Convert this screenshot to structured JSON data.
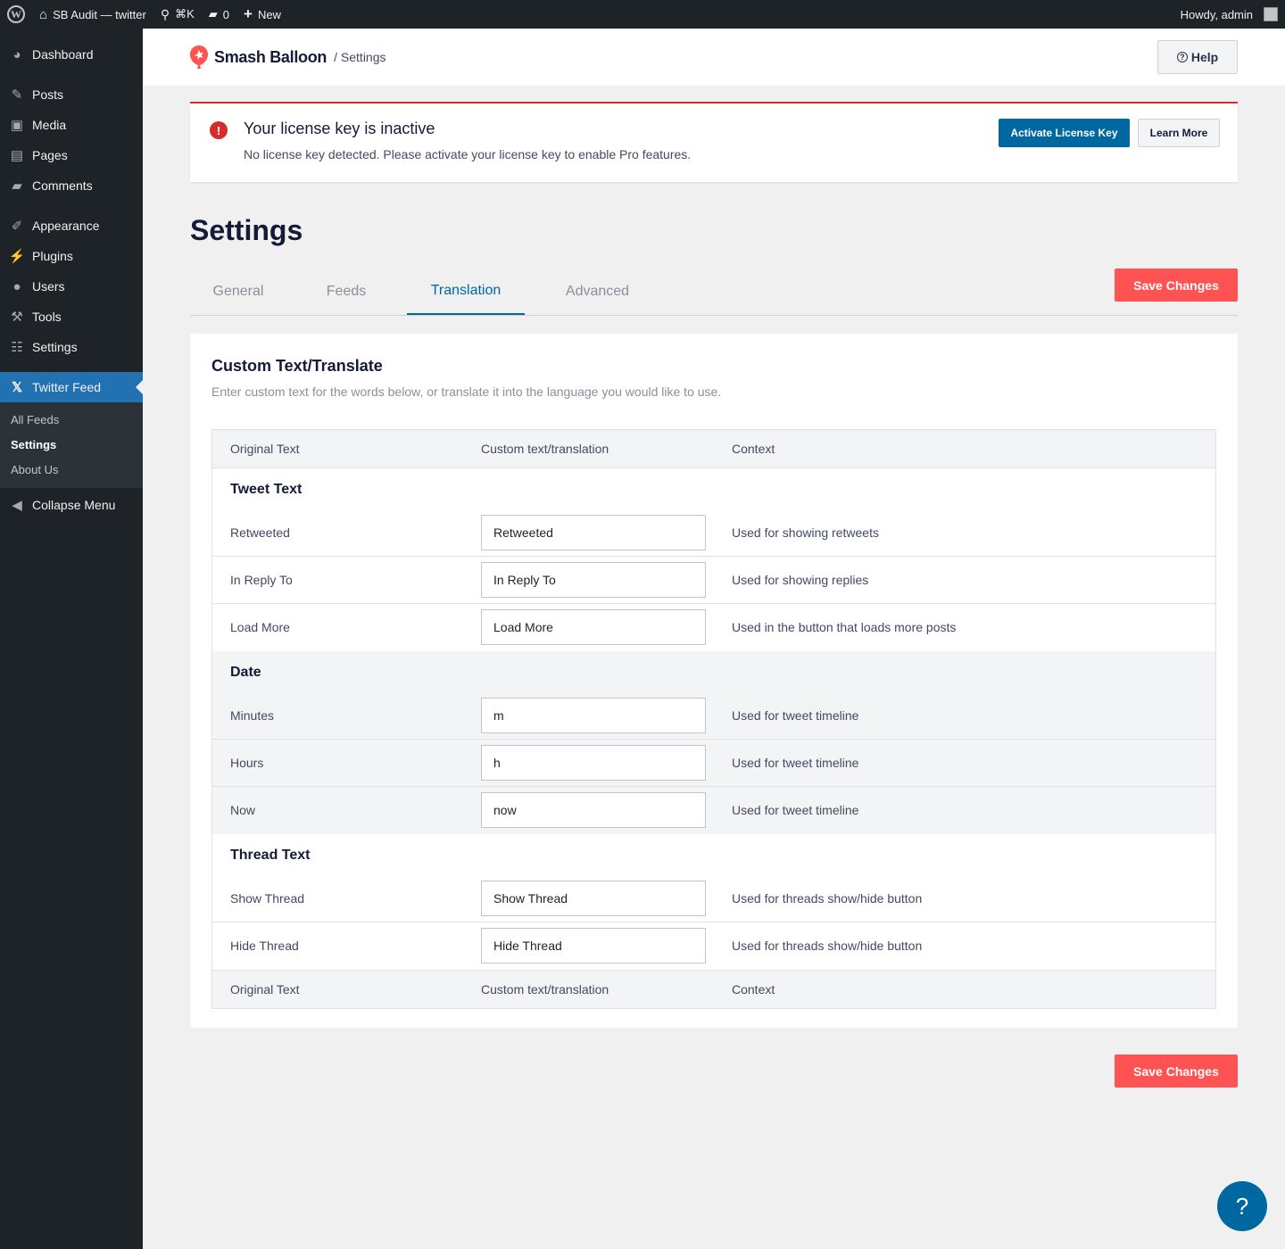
{
  "adminbar": {
    "site_name": "SB Audit — twitter",
    "shortcut": "⌘K",
    "comments_count": "0",
    "new_label": "New",
    "howdy": "Howdy, admin"
  },
  "sidebar": {
    "items": [
      {
        "label": "Dashboard",
        "icon": "dashboard-icon"
      },
      {
        "label": "Posts",
        "icon": "pin-icon"
      },
      {
        "label": "Media",
        "icon": "media-icon"
      },
      {
        "label": "Pages",
        "icon": "pages-icon"
      },
      {
        "label": "Comments",
        "icon": "comment-icon"
      },
      {
        "label": "Appearance",
        "icon": "brush-icon"
      },
      {
        "label": "Plugins",
        "icon": "plug-icon"
      },
      {
        "label": "Users",
        "icon": "user-icon"
      },
      {
        "label": "Tools",
        "icon": "wrench-icon"
      },
      {
        "label": "Settings",
        "icon": "sliders-icon"
      },
      {
        "label": "Twitter Feed",
        "icon": "x-icon"
      }
    ],
    "submenu": [
      "All Feeds",
      "Settings",
      "About Us"
    ],
    "collapse": "Collapse Menu"
  },
  "header": {
    "brand": "Smash Balloon",
    "crumb": "/ Settings",
    "help": "Help"
  },
  "notice": {
    "title": "Your license key is inactive",
    "text": "No license key detected. Please activate your license key to enable Pro features.",
    "activate": "Activate License Key",
    "learn": "Learn More"
  },
  "page": {
    "title": "Settings",
    "tabs": [
      "General",
      "Feeds",
      "Translation",
      "Advanced"
    ],
    "active_tab": "Translation",
    "save": "Save Changes"
  },
  "card": {
    "title": "Custom Text/Translate",
    "desc": "Enter custom text for the words below, or translate it into the language you would like to use.",
    "columns": [
      "Original Text",
      "Custom text/translation",
      "Context"
    ],
    "groups": [
      {
        "title": "Tweet Text",
        "rows": [
          {
            "original": "Retweeted",
            "value": "Retweeted",
            "context": "Used for showing retweets"
          },
          {
            "original": "In Reply To",
            "value": "In Reply To",
            "context": "Used for showing replies"
          },
          {
            "original": "Load More",
            "value": "Load More",
            "context": "Used in the button that loads more posts"
          }
        ]
      },
      {
        "title": "Date",
        "rows": [
          {
            "original": "Minutes",
            "value": "m",
            "context": "Used for tweet timeline"
          },
          {
            "original": "Hours",
            "value": "h",
            "context": "Used for tweet timeline"
          },
          {
            "original": "Now",
            "value": "now",
            "context": "Used for tweet timeline"
          }
        ]
      },
      {
        "title": "Thread Text",
        "rows": [
          {
            "original": "Show Thread",
            "value": "Show Thread",
            "context": "Used for threads show/hide button"
          },
          {
            "original": "Hide Thread",
            "value": "Hide Thread",
            "context": "Used for threads show/hide button"
          }
        ]
      }
    ]
  },
  "fab": "?",
  "colors": {
    "admin_dark": "#1d2327",
    "accent_blue": "#0068a0",
    "menu_current": "#2271b1",
    "save_red": "#ff5252",
    "notice_red": "#d72c2c"
  }
}
